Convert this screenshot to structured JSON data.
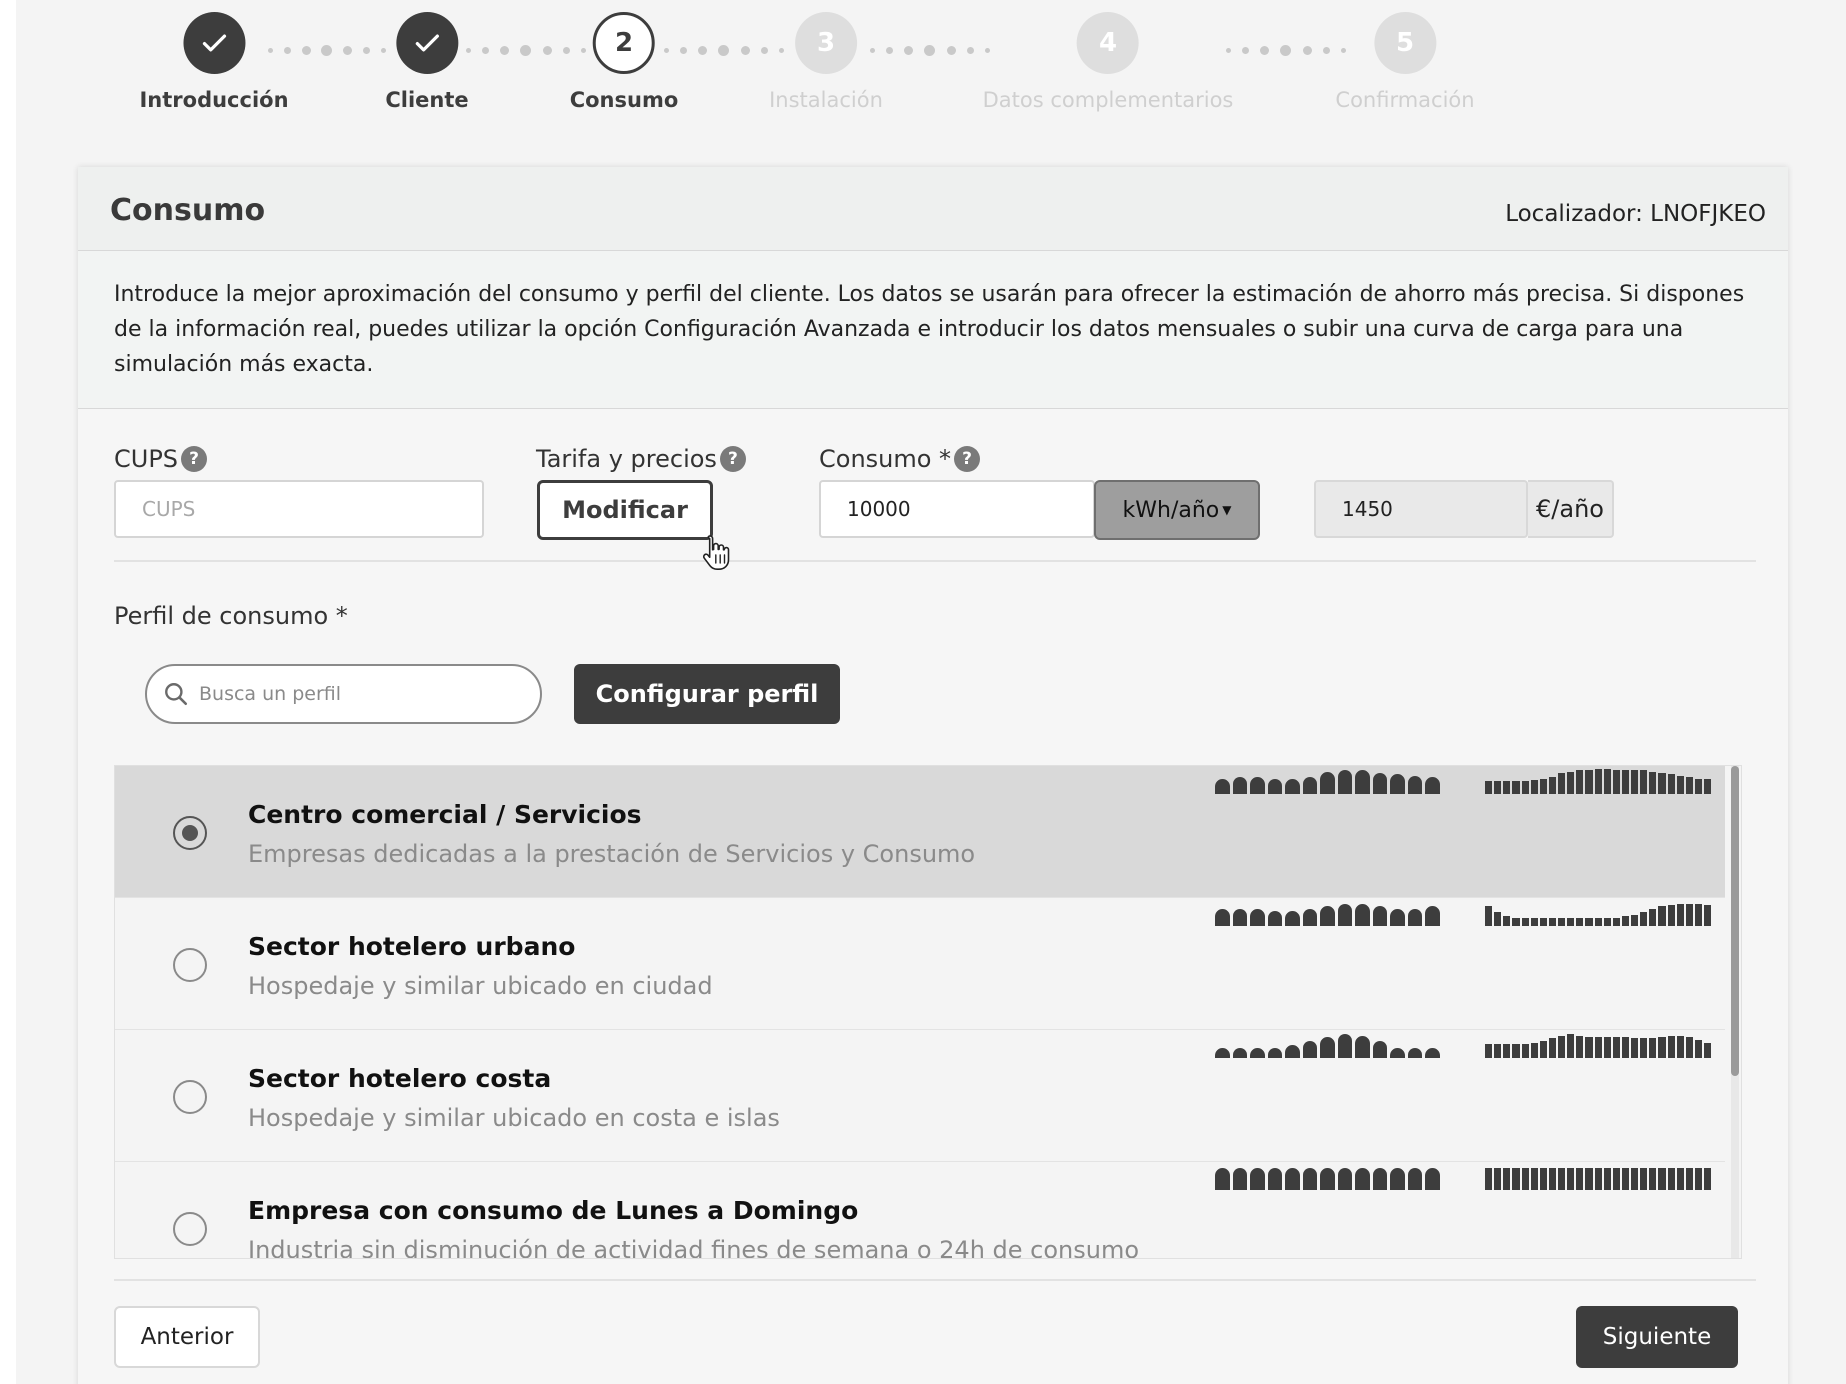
{
  "stepper": {
    "steps": [
      {
        "label": "Introducción",
        "number": "",
        "state": "done"
      },
      {
        "label": "Cliente",
        "number": "",
        "state": "done"
      },
      {
        "label": "Consumo",
        "number": "2",
        "state": "active"
      },
      {
        "label": "Instalación",
        "number": "3",
        "state": "future"
      },
      {
        "label": "Datos complementarios",
        "number": "4",
        "state": "future"
      },
      {
        "label": "Confirmación",
        "number": "5",
        "state": "future"
      }
    ]
  },
  "card": {
    "title": "Consumo",
    "locator": "Localizador: LNOFJKEO",
    "intro": "Introduce la mejor aproximación del consumo y perfil del cliente. Los datos se usarán para ofrecer la estimación de ahorro más precisa. Si dispones de la información real, puedes utilizar la opción Configuración Avanzada e introducir los datos mensuales o subir una curva de carga para una simulación más exacta."
  },
  "form": {
    "cups_label": "CUPS",
    "cups_placeholder": "CUPS",
    "tarifa_label": "Tarifa y precios",
    "modify_button": "Modificar",
    "consumo_label": "Consumo *",
    "consumo_value": "10000",
    "unit_select": "kWh/año",
    "cost_value": "1450",
    "cost_unit": "€/año"
  },
  "profile": {
    "label": "Perfil de consumo *",
    "search_placeholder": "Busca un perfil",
    "configure_button": "Configurar perfil",
    "items": [
      {
        "title": "Centro comercial / Servicios",
        "desc": "Empresas dedicadas a la prestación de Servicios y Consumo",
        "selected": true,
        "monthly": [
          0.55,
          0.6,
          0.6,
          0.55,
          0.55,
          0.6,
          0.8,
          0.85,
          0.85,
          0.75,
          0.7,
          0.65,
          0.6
        ],
        "hourly": [
          0.45,
          0.45,
          0.45,
          0.45,
          0.45,
          0.5,
          0.55,
          0.6,
          0.75,
          0.8,
          0.85,
          0.85,
          0.9,
          0.9,
          0.85,
          0.85,
          0.85,
          0.85,
          0.8,
          0.75,
          0.7,
          0.65,
          0.6,
          0.55,
          0.55
        ]
      },
      {
        "title": "Sector hotelero urbano",
        "desc": "Hospedaje y similar ubicado en ciudad",
        "selected": false,
        "monthly": [
          0.6,
          0.6,
          0.6,
          0.55,
          0.55,
          0.6,
          0.7,
          0.8,
          0.8,
          0.7,
          0.6,
          0.6,
          0.7
        ],
        "hourly": [
          0.7,
          0.5,
          0.35,
          0.3,
          0.3,
          0.3,
          0.3,
          0.3,
          0.3,
          0.3,
          0.3,
          0.3,
          0.3,
          0.3,
          0.3,
          0.35,
          0.4,
          0.5,
          0.6,
          0.7,
          0.75,
          0.8,
          0.8,
          0.8,
          0.75
        ]
      },
      {
        "title": "Sector hotelero costa",
        "desc": "Hospedaje y similar ubicado en costa e islas",
        "selected": false,
        "monthly": [
          0.35,
          0.35,
          0.35,
          0.35,
          0.45,
          0.6,
          0.75,
          0.85,
          0.8,
          0.6,
          0.35,
          0.35,
          0.35
        ],
        "hourly": [
          0.5,
          0.5,
          0.5,
          0.5,
          0.5,
          0.55,
          0.6,
          0.7,
          0.8,
          0.85,
          0.8,
          0.75,
          0.75,
          0.75,
          0.75,
          0.75,
          0.7,
          0.7,
          0.7,
          0.75,
          0.8,
          0.8,
          0.75,
          0.65,
          0.55
        ]
      },
      {
        "title": "Empresa con consumo de Lunes a Domingo",
        "desc": "Industria sin disminución de actividad fines de semana o 24h de consumo",
        "selected": false,
        "monthly": [
          0.8,
          0.8,
          0.8,
          0.8,
          0.8,
          0.8,
          0.8,
          0.8,
          0.8,
          0.8,
          0.8,
          0.8,
          0.8
        ],
        "hourly": [
          0.8,
          0.8,
          0.8,
          0.8,
          0.8,
          0.8,
          0.8,
          0.8,
          0.8,
          0.8,
          0.8,
          0.8,
          0.8,
          0.8,
          0.8,
          0.8,
          0.8,
          0.8,
          0.8,
          0.8,
          0.8,
          0.8,
          0.8,
          0.8,
          0.8
        ]
      }
    ]
  },
  "footer": {
    "prev_button": "Anterior",
    "next_button": "Siguiente"
  },
  "colors": {
    "accent": "#3d3d3d",
    "selected_row": "#d9d9d9",
    "future_step": "#dedede"
  }
}
